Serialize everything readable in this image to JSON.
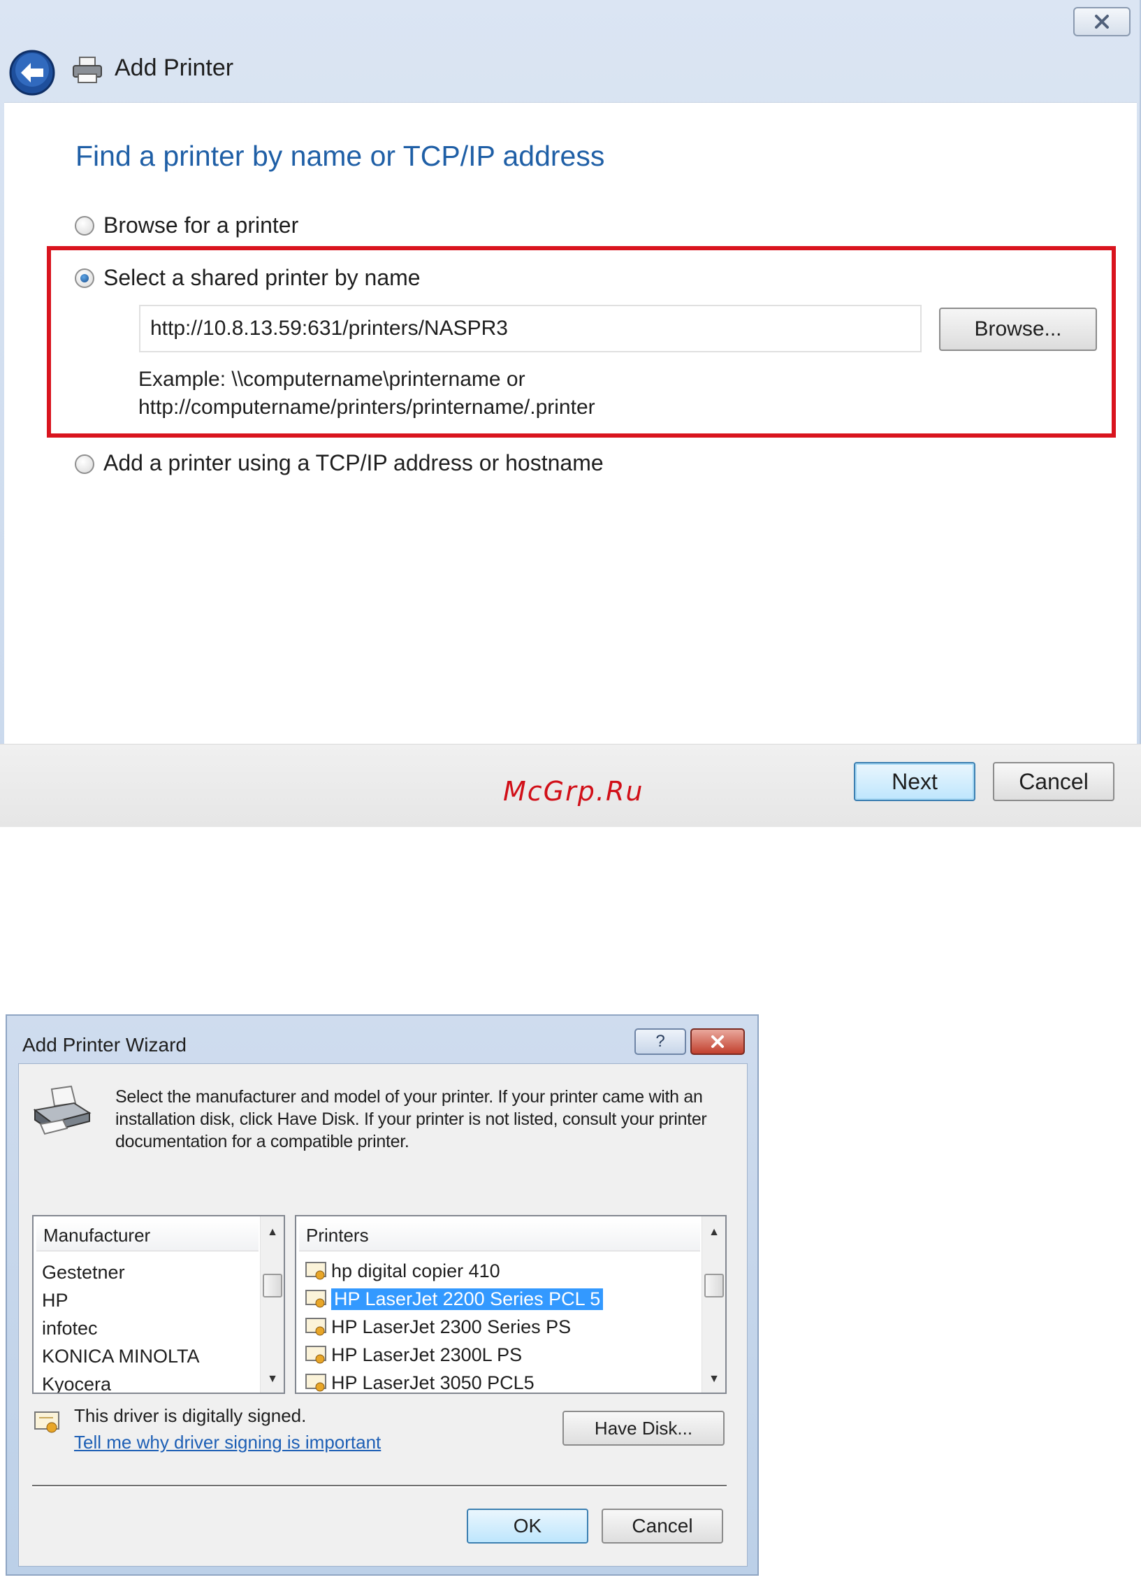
{
  "add_printer": {
    "title": "Add Printer",
    "heading": "Find a printer by name or TCP/IP address",
    "options": [
      {
        "label": "Browse for a printer",
        "selected": false
      },
      {
        "label": "Select a shared printer by name",
        "selected": true
      },
      {
        "label": "Add a printer using a TCP/IP address or hostname",
        "selected": false
      }
    ],
    "shared_printer_value": "http://10.8.13.59:631/printers/NASPR3",
    "browse_label": "Browse...",
    "example_line1": "Example: \\\\computername\\printername or",
    "example_line2": "http://computername/printers/printername/.printer",
    "next_label": "Next",
    "cancel_label": "Cancel",
    "watermark": "McGrp.Ru",
    "highlight_color": "#d9141e",
    "heading_color": "#1f5fa6"
  },
  "wizard": {
    "title": "Add Printer Wizard",
    "help_label": "?",
    "instructions": "Select the manufacturer and model of your printer. If your printer came with an installation disk, click Have Disk. If your printer is not listed, consult your printer documentation for a compatible printer.",
    "manufacturer_header": "Manufacturer",
    "manufacturers": [
      "Gestetner",
      "HP",
      "infotec",
      "KONICA MINOLTA",
      "Kyocera"
    ],
    "printers_header": "Printers",
    "printers": [
      {
        "name": "hp digital copier 410",
        "selected": false
      },
      {
        "name": "HP LaserJet 2200 Series PCL 5",
        "selected": true
      },
      {
        "name": "HP LaserJet 2300 Series PS",
        "selected": false
      },
      {
        "name": "HP LaserJet 2300L PS",
        "selected": false
      },
      {
        "name": "HP LaserJet 3050 PCL5",
        "selected": false
      }
    ],
    "signed_text": "This driver is digitally signed.",
    "signed_link": "Tell me why driver signing is important",
    "have_disk_label": "Have Disk...",
    "ok_label": "OK",
    "cancel_label": "Cancel",
    "selection_color": "#3399ff"
  }
}
